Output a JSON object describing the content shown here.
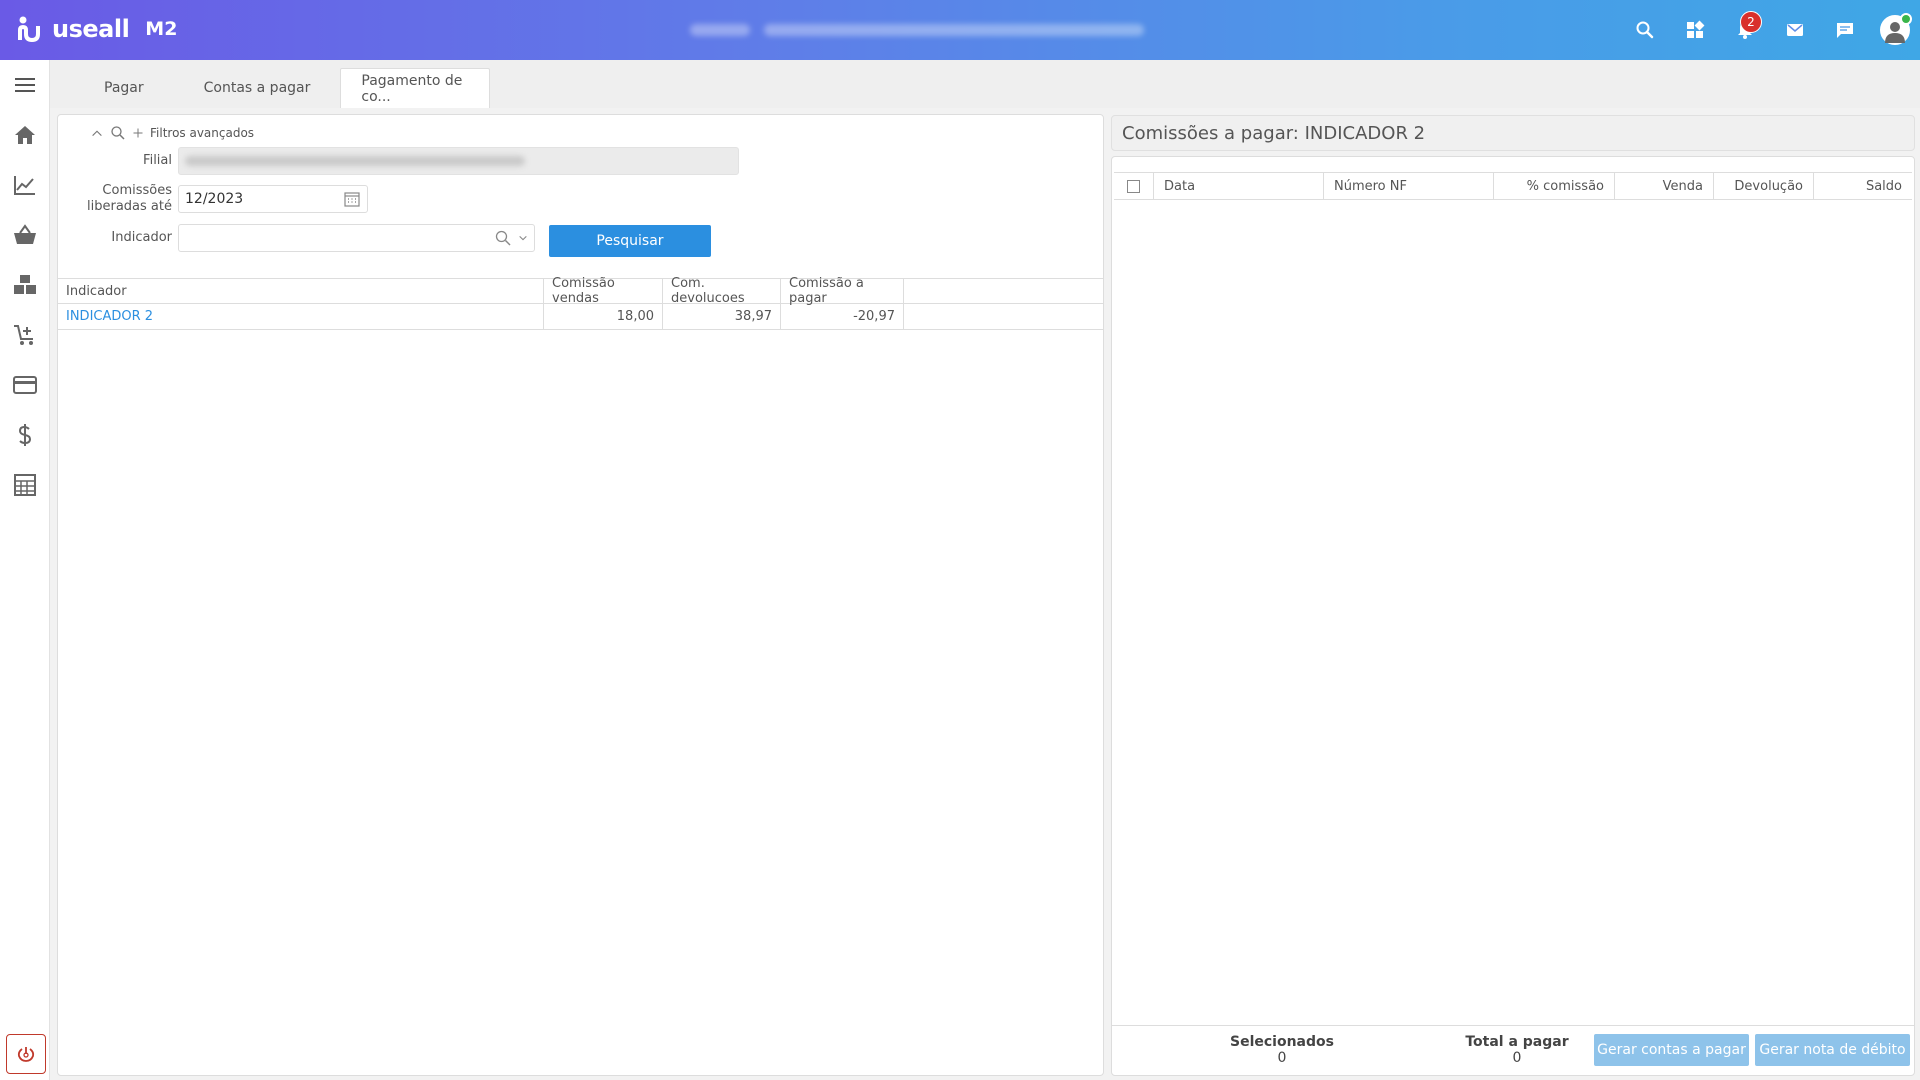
{
  "app": {
    "logo_text": "useall",
    "logo_sub": "M2",
    "notification_count": "2"
  },
  "tabs": [
    {
      "label": "Pagar"
    },
    {
      "label": "Contas a pagar"
    },
    {
      "label": "Pagamento de co..."
    }
  ],
  "filters": {
    "toggle_label": "Filtros avançados",
    "filial_label": "Filial",
    "comissoes_label_line1": "Comissões",
    "comissoes_label_line2": "liberadas até",
    "comissoes_value": "12/2023",
    "indicador_label": "Indicador",
    "indicador_value": "",
    "search_button": "Pesquisar"
  },
  "left_grid": {
    "columns": [
      "Indicador",
      "Comissão vendas",
      "Com. devolucoes",
      "Comissão a pagar"
    ],
    "rows": [
      {
        "indicador": "INDICADOR 2",
        "comissao_vendas": "18,00",
        "com_devolucoes": "38,97",
        "comissao_a_pagar": "-20,97"
      }
    ]
  },
  "right": {
    "title": "Comissões a pagar: INDICADOR 2",
    "columns": [
      "Data",
      "Número NF",
      "% comissão",
      "Venda",
      "Devolução",
      "Saldo"
    ],
    "footer": {
      "selecionados_label": "Selecionados",
      "selecionados_value": "0",
      "total_label": "Total a pagar",
      "total_value": "0",
      "gerar_contas_button": "Gerar contas a pagar",
      "gerar_nota_button": "Gerar nota de débito"
    }
  },
  "colors": {
    "accent": "#2b8fe0",
    "header_start": "#6a5ae6",
    "header_end": "#3fa7e6",
    "badge": "#d9302c"
  }
}
